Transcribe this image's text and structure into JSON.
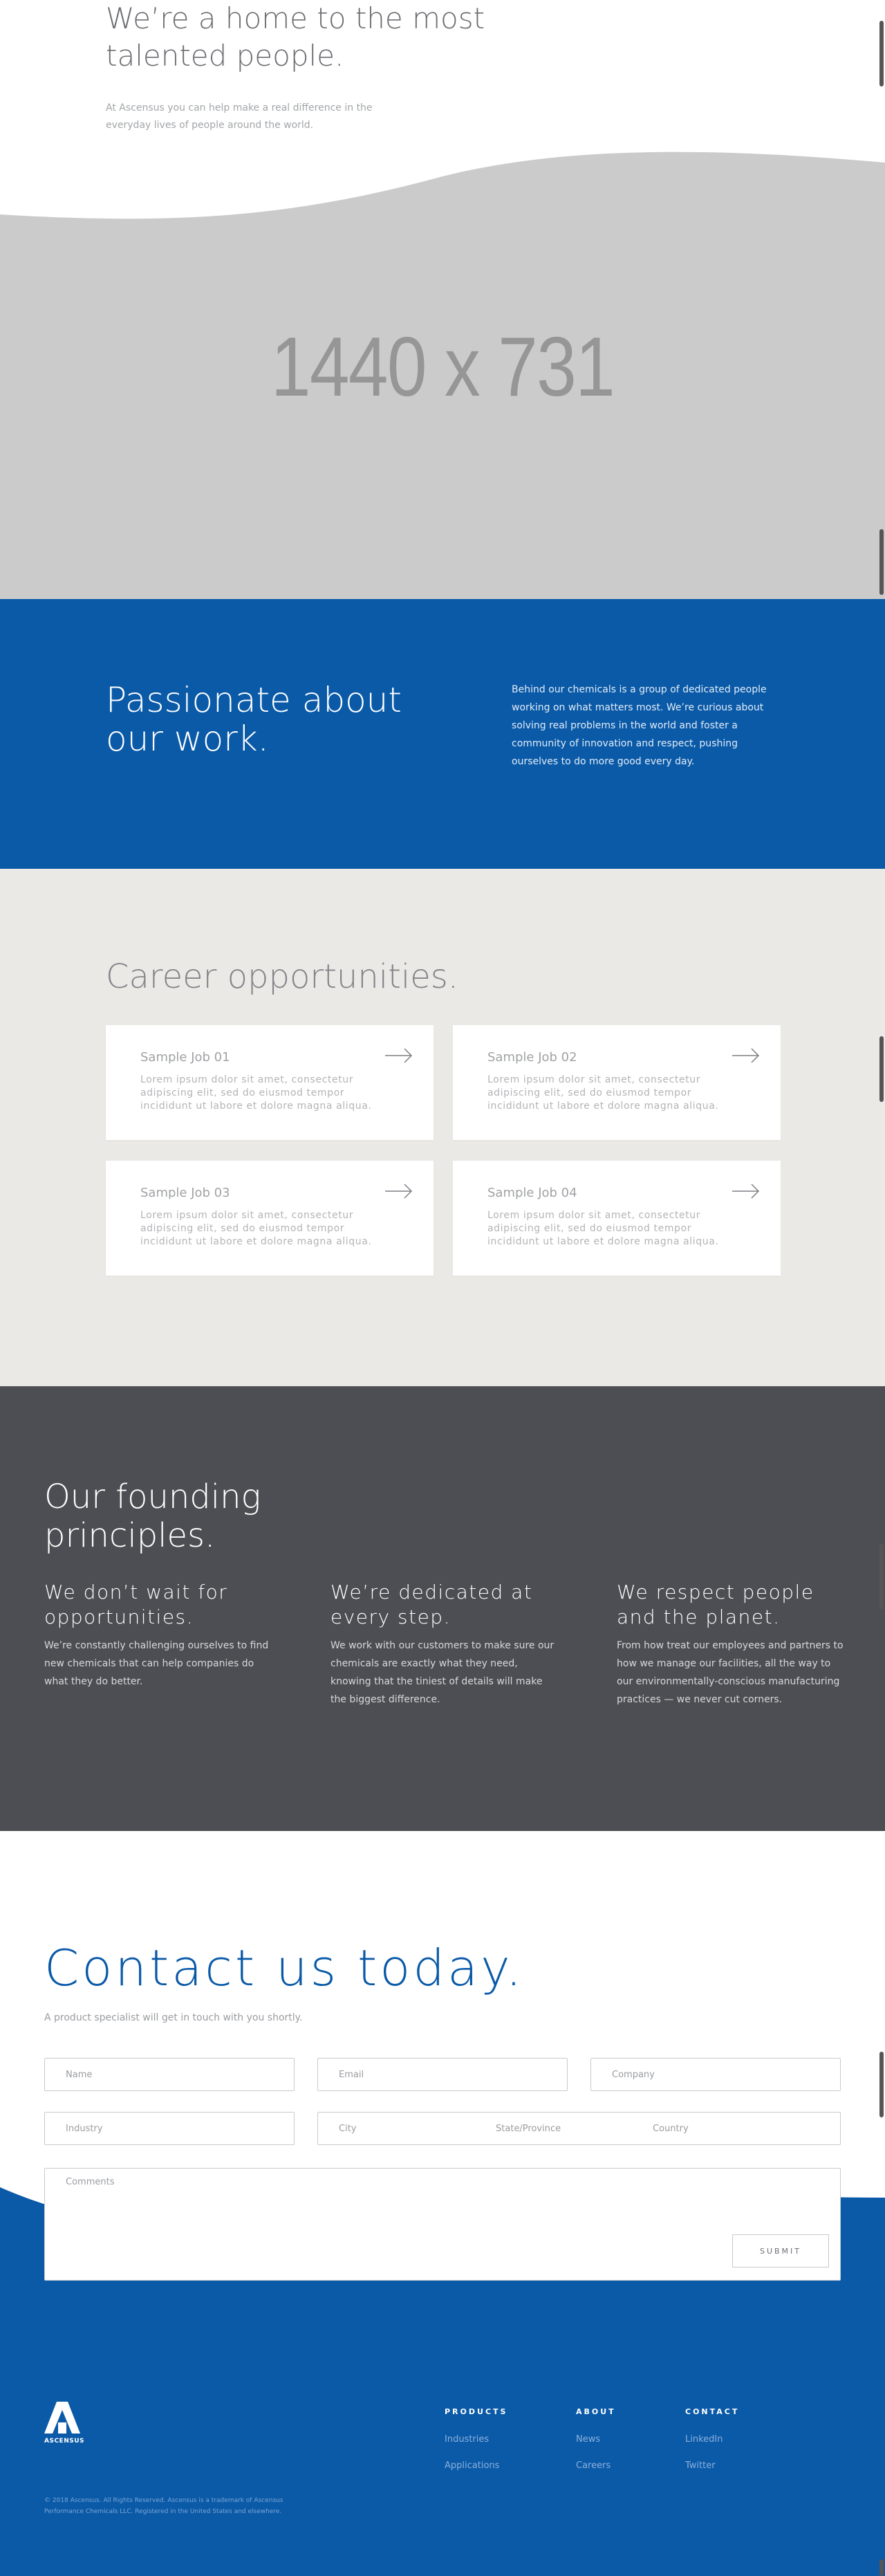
{
  "hero": {
    "title": "We’re a home to the most talented people.",
    "subtitle": "At Ascensus you can help make a real difference in the everyday lives of people around the world.",
    "image_label": "1440 x 731"
  },
  "passion": {
    "title": "Passionate about our work.",
    "text": "Behind our chemicals is a group of dedicated people working on what matters most. We’re curious about solving real problems in the world and foster a community of innovation and respect, pushing ourselves to do more good every day."
  },
  "careers": {
    "title": "Career opportunities.",
    "jobs": [
      {
        "title": "Sample Job 01",
        "description": "Lorem ipsum dolor sit amet, consectetur adipiscing elit, sed do eiusmod tempor incididunt ut labore et dolore magna aliqua."
      },
      {
        "title": "Sample Job 02",
        "description": "Lorem ipsum dolor sit amet, consectetur adipiscing elit, sed do eiusmod tempor incididunt ut labore et dolore magna aliqua."
      },
      {
        "title": "Sample Job 03",
        "description": "Lorem ipsum dolor sit amet, consectetur adipiscing elit, sed do eiusmod tempor incididunt ut labore et dolore magna aliqua."
      },
      {
        "title": "Sample Job 04",
        "description": "Lorem ipsum dolor sit amet, consectetur adipiscing elit, sed do eiusmod tempor incididunt ut labore et dolore magna aliqua."
      }
    ]
  },
  "principles": {
    "title": "Our founding principles.",
    "items": [
      {
        "title": "We don’t wait for opportunities.",
        "text": "We’re constantly challenging ourselves to find new chemicals that can help companies do what they do better."
      },
      {
        "title": "We’re dedicated at every step.",
        "text": "We work with our customers to make sure our chemicals are exactly what they need, knowing that the tiniest of details will make the biggest difference."
      },
      {
        "title": "We respect people and the planet.",
        "text": "From how treat our employees and partners to how we manage our facilities, all the way to our environmentally-conscious manufacturing practices — we never cut corners."
      }
    ]
  },
  "contact": {
    "title": "Contact us today.",
    "subtitle": "A product specialist will get in touch with you shortly.",
    "placeholders": {
      "name": "Name",
      "email": "Email",
      "company": "Company",
      "industry": "Industry",
      "city": "City",
      "state": "State/Province",
      "country": "Country",
      "comments": "Comments"
    },
    "submit_label": "SUBMIT"
  },
  "footer": {
    "logo_text": "ASCENSUS",
    "legal": "© 2018 Ascensus. All Rights Reserved. Ascensus is a trademark of Ascensus Performance Chemicals LLC. Registered in the United States and elsewhere.",
    "columns": [
      {
        "title": "PRODUCTS",
        "links": [
          "Industries",
          "Applications"
        ]
      },
      {
        "title": "ABOUT",
        "links": [
          "News",
          "Careers"
        ]
      },
      {
        "title": "CONTACT",
        "links": [
          "LinkedIn",
          "Twitter"
        ]
      }
    ]
  },
  "colors": {
    "brand_blue": "#0a5aa8",
    "dark_gray": "#4d4e53",
    "light_beige": "#ebe9e6",
    "placeholder_gray": "#cbcbcb"
  }
}
